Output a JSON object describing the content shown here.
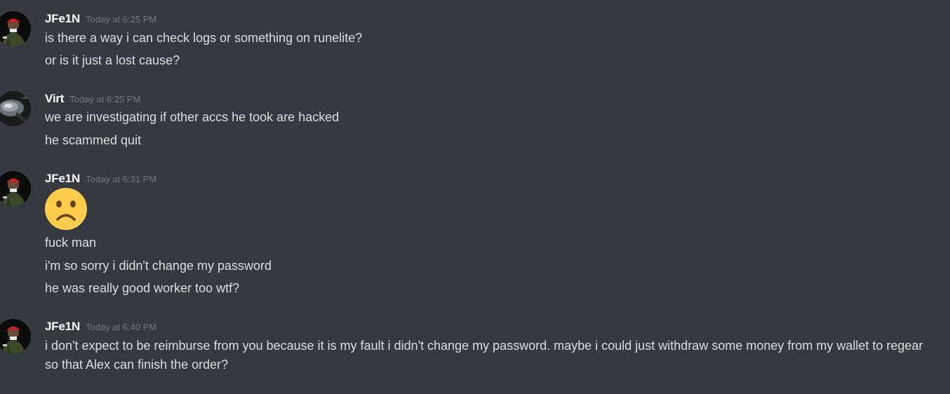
{
  "messages": [
    {
      "username": "JFe1N",
      "timestamp": "Today at 6:25 PM",
      "avatar_icon": "red-cap-green-jacket-avatar",
      "lines": [
        "is there a way i can check logs or something on runelite?",
        "or is it just a lost cause?"
      ]
    },
    {
      "username": "Virt",
      "timestamp": "Today at 6:25 PM",
      "avatar_icon": "dark-metallic-avatar",
      "lines": [
        "we are investigating if other accs he took are hacked",
        "he scammed quit"
      ]
    },
    {
      "username": "JFe1N",
      "timestamp": "Today at 6:31 PM",
      "avatar_icon": "red-cap-green-jacket-avatar",
      "emoji_icon": "frowning-face-emoji",
      "lines": [
        "fuck man",
        "i'm so sorry i didn't change my password",
        "he was really good worker too wtf?"
      ]
    },
    {
      "username": "JFe1N",
      "timestamp": "Today at 6:40 PM",
      "avatar_icon": "red-cap-green-jacket-avatar",
      "lines": [
        "i don't expect to be reimburse from you because it is my fault i didn't change my password. maybe i could just withdraw some money from my wallet to regear so that Alex can finish the order?"
      ]
    }
  ],
  "colors": {
    "background": "#36393f",
    "username": "#ffffff",
    "timestamp": "#72767d",
    "message_text": "#dcddde",
    "emoji_face": "#ffcc4d"
  }
}
